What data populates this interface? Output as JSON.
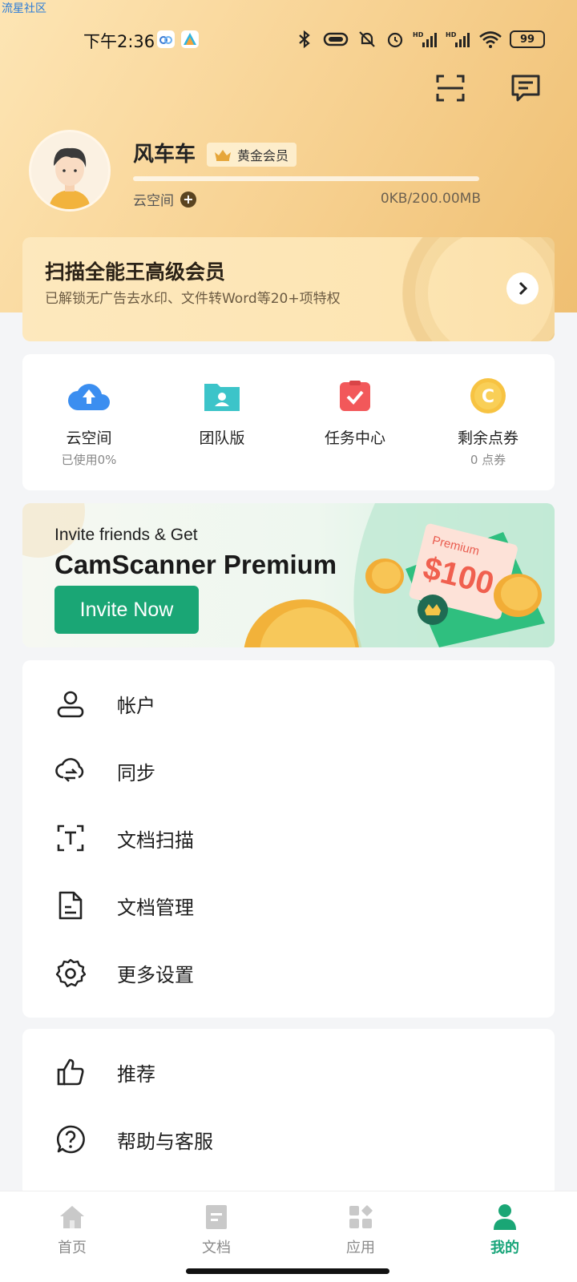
{
  "watermark": "流星社区",
  "status_bar": {
    "time": "下午2:36",
    "battery": "99"
  },
  "profile": {
    "name": "风车车",
    "vip_label": "黄金会员",
    "cloud_label": "云空间",
    "storage": "0KB/200.00MB"
  },
  "premium_card": {
    "title": "扫描全能王高级会员",
    "subtitle": "已解锁无广告去水印、文件转Word等20+项特权"
  },
  "quick_items": [
    {
      "label": "云空间",
      "sub": "已使用0%"
    },
    {
      "label": "团队版",
      "sub": ""
    },
    {
      "label": "任务中心",
      "sub": ""
    },
    {
      "label": "剩余点券",
      "sub": "0 点券"
    }
  ],
  "invite": {
    "line1": "Invite friends & Get",
    "line2": "CamScanner Premium",
    "button": "Invite Now",
    "ticket_top": "Premium",
    "ticket_amount": "$100"
  },
  "menu_primary": [
    {
      "label": "帐户",
      "icon": "person-icon"
    },
    {
      "label": "同步",
      "icon": "cloud-sync-icon"
    },
    {
      "label": "文档扫描",
      "icon": "scan-text-icon"
    },
    {
      "label": "文档管理",
      "icon": "document-icon"
    },
    {
      "label": "更多设置",
      "icon": "gear-icon"
    }
  ],
  "menu_secondary": [
    {
      "label": "推荐",
      "icon": "thumbs-up-icon"
    },
    {
      "label": "帮助与客服",
      "icon": "help-icon"
    }
  ],
  "bottom_nav": [
    {
      "label": "首页",
      "icon": "home-icon"
    },
    {
      "label": "文档",
      "icon": "document-icon"
    },
    {
      "label": "应用",
      "icon": "apps-icon"
    },
    {
      "label": "我的",
      "icon": "profile-icon",
      "active": true
    }
  ],
  "colors": {
    "accent_green": "#1aa675",
    "gold": "#efbf72"
  }
}
